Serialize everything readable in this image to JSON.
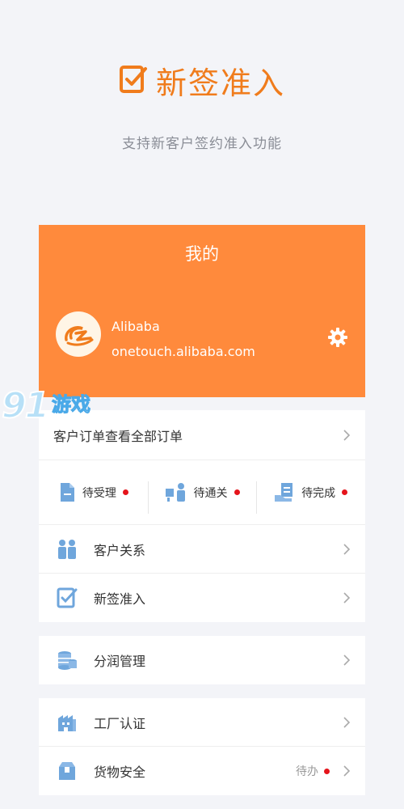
{
  "hero": {
    "title": "新签准入",
    "subtitle": "支持新客户签约准入功能"
  },
  "header": {
    "title": "我的",
    "user_name": "Alibaba",
    "user_email": "onetouch.alibaba.com"
  },
  "orders": {
    "label": "客户订单",
    "view_all": "查看全部订单",
    "statuses": [
      {
        "label": "待受理",
        "icon": "document-icon"
      },
      {
        "label": "待通关",
        "icon": "customs-icon"
      },
      {
        "label": "待完成",
        "icon": "hand-document-icon"
      }
    ]
  },
  "menu": {
    "customer_relations": "客户关系",
    "new_sign": "新签准入",
    "profit_sharing": "分润管理",
    "factory_cert": "工厂认证",
    "cargo_safety": "货物安全",
    "cargo_safety_status": "待办"
  },
  "watermark": {
    "number": "91",
    "name": "游戏",
    "url": "91danji.com"
  },
  "colors": {
    "accent": "#ff8a3c",
    "title": "#f07c1c",
    "icon_blue": "#6fa6dc",
    "badge_red": "#e5141b"
  }
}
